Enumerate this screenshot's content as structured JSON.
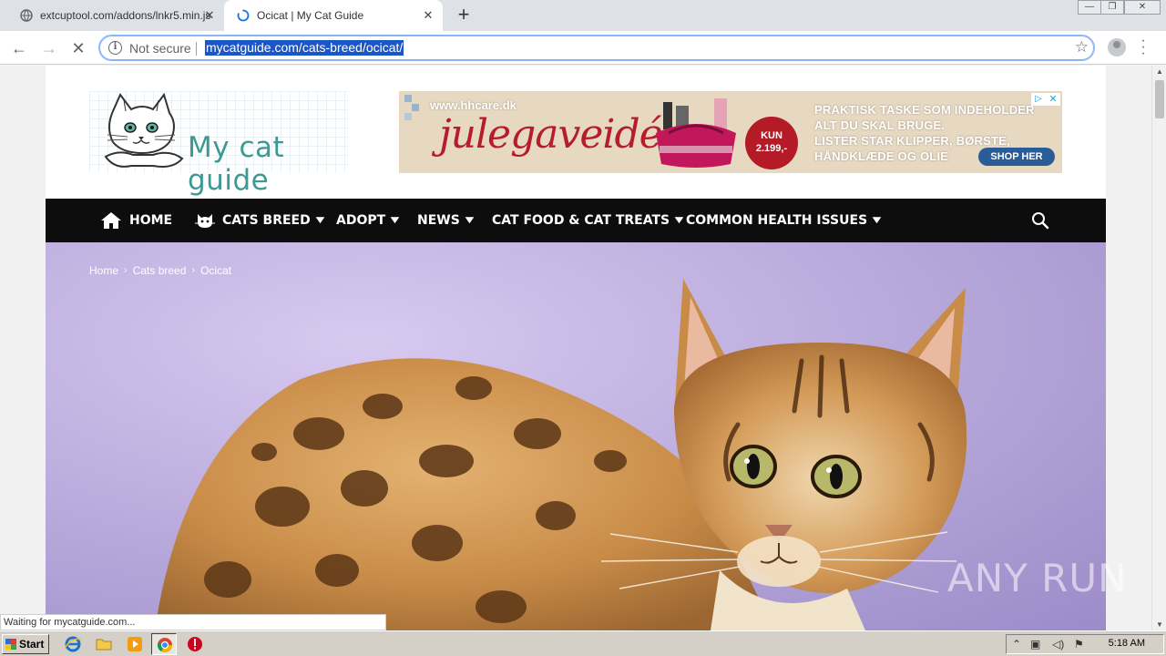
{
  "browser": {
    "tabs": [
      {
        "title": "extcuptool.com/addons/lnkr5.min.js",
        "active": false
      },
      {
        "title": "Ocicat | My Cat Guide",
        "active": true
      }
    ],
    "new_tab": "+",
    "omnibox": {
      "security_label": "Not secure",
      "url": "mycatguide.com/cats-breed/ocicat/"
    },
    "status_text": "Waiting for mycatguide.com..."
  },
  "site": {
    "logo_text": "My cat guide",
    "ad": {
      "site_url": "www.hhcare.dk",
      "headline": "julegaveidé",
      "price_line1": "KUN",
      "price_line2": "2.199,-",
      "copy_lines": [
        "PRAKTISK TASKE SOM INDEHOLDER",
        "ALT DU SKAL BRUGE.",
        "LISTER STAR KLIPPER, BØRSTE,",
        "HÅNDKLÆDE OG OLIE"
      ],
      "cta": "SHOP HER"
    },
    "nav": [
      {
        "label": "HOME",
        "icon": "home-icon",
        "dropdown": false
      },
      {
        "label": "CATS BREED",
        "icon": "cat-icon",
        "dropdown": true
      },
      {
        "label": "ADOPT",
        "dropdown": true
      },
      {
        "label": "NEWS",
        "dropdown": true
      },
      {
        "label": "CAT FOOD & CAT TREATS",
        "dropdown": true
      },
      {
        "label": "COMMON HEALTH ISSUES",
        "dropdown": true
      }
    ],
    "breadcrumb": [
      "Home",
      "Cats breed",
      "Ocicat"
    ]
  },
  "watermark": "ANY RUN",
  "taskbar": {
    "start_label": "Start",
    "time": "5:18 AM"
  },
  "colors": {
    "nav_bg": "#0d0d0d",
    "logo_teal": "#3d9a93",
    "ad_red": "#b51d2b",
    "hero_purple": "#b6a7da"
  }
}
